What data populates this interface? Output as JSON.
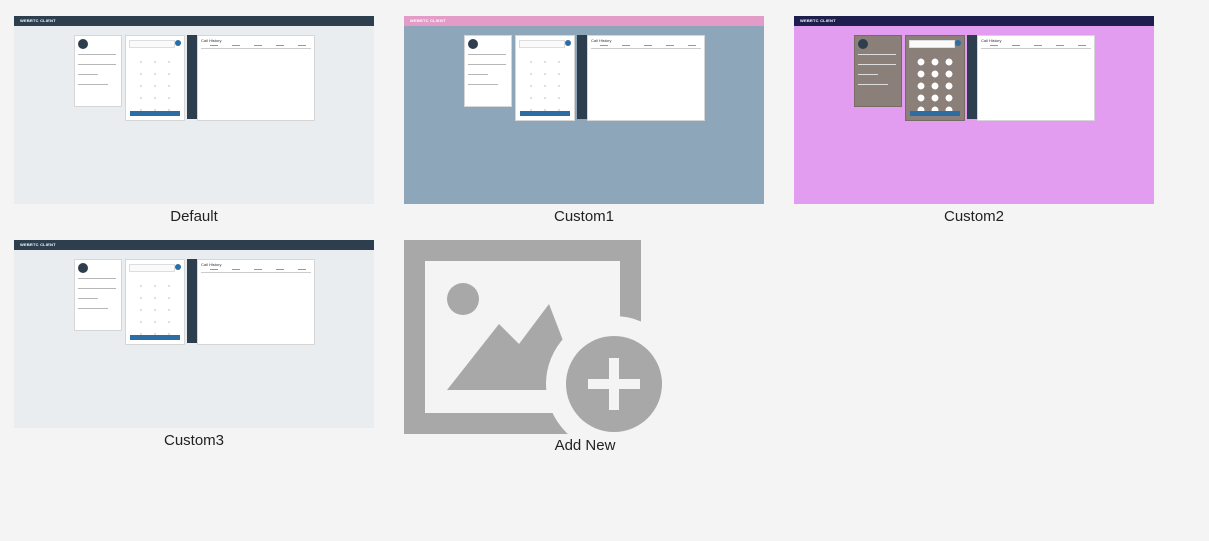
{
  "themes": [
    {
      "label": "Default",
      "colors": {
        "page": "#e9edf0",
        "header": "#2d3e4f",
        "accent": "#2e6da4",
        "panel": "#ffffff"
      },
      "brand": "WEBRTC CLIENT",
      "history_title": "Call History"
    },
    {
      "label": "Custom1",
      "colors": {
        "page": "#8da6ba",
        "header": "#e39cc8",
        "accent": "#2e6da4",
        "panel": "#ffffff"
      },
      "brand": "WEBRTC CLIENT",
      "history_title": "Call History"
    },
    {
      "label": "Custom2",
      "colors": {
        "page": "#e29cf0",
        "header": "#1e1e4e",
        "accent": "#2e6da4",
        "panel": "#8b7f7a"
      },
      "brand": "WEBRTC CLIENT",
      "history_title": "Call History"
    },
    {
      "label": "Custom3",
      "colors": {
        "page": "#e9edf0",
        "header": "#2d3e4f",
        "accent": "#2e6da4",
        "panel": "#ffffff"
      },
      "brand": "WEBRTC CLIENT",
      "history_title": "Call History"
    }
  ],
  "add_new": {
    "label": "Add New",
    "icon": "add-image-icon",
    "icon_color": "#a8a8a8"
  }
}
